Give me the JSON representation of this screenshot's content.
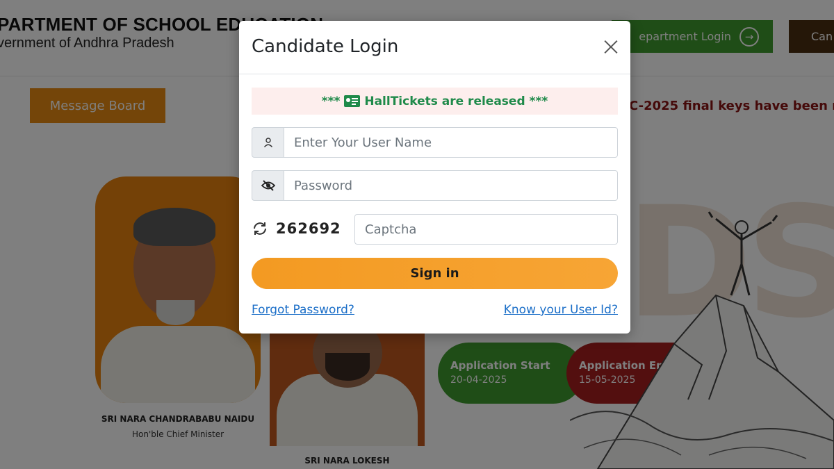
{
  "background": {
    "dept_title": "PARTMENT OF SCHOOL EDUCATION",
    "dept_subtitle": "vernment of Andhra Pradesh",
    "department_login_label": "epartment Login",
    "candidate_btn_label": "Can",
    "message_board_label": "Message Board",
    "marquee_text": "C-2025 final keys have been re",
    "cm_name": "SRI NARA CHANDRABABU NAIDU",
    "cm_role": "Hon'ble Chief Minister",
    "minister_name": "SRI NARA LOKESH",
    "application_start": {
      "label": "Application Start",
      "date": "20-04-2025"
    },
    "application_end": {
      "label": "Application End",
      "date": "15-05-2025"
    },
    "watermark_letters": "DSC"
  },
  "modal": {
    "title": "Candidate Login",
    "notice": {
      "prefix": "***",
      "text": "HallTickets are released",
      "suffix": "***",
      "icon": "id-card-icon"
    },
    "username": {
      "placeholder": "Enter Your User Name",
      "value": "",
      "icon": "user-icon"
    },
    "password": {
      "placeholder": "Password",
      "value": "",
      "icon": "eye-slash-icon"
    },
    "captcha": {
      "code": "262692",
      "placeholder": "Captcha",
      "value": "",
      "icon": "refresh-icon"
    },
    "signin_label": "Sign in",
    "forgot_password_label": "Forgot Password?",
    "know_user_id_label": "Know your User Id?"
  },
  "colors": {
    "accent_orange": "#f39a22",
    "notice_green": "#1f8a4a",
    "link_blue": "#1c6fc8",
    "start_green": "#3f9a2f",
    "end_red": "#a61f1f"
  }
}
